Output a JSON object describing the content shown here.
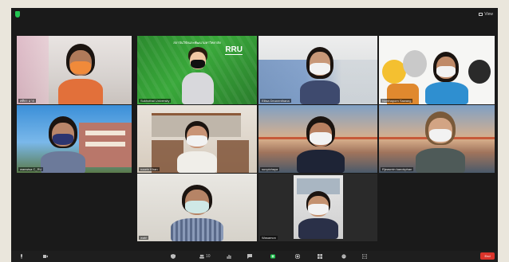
{
  "app": {
    "view_label": "View",
    "end_label": "End"
  },
  "participants": [
    {
      "id": "p1",
      "name": "ศศิธร มาก"
    },
    {
      "id": "p2",
      "name": "Sukhothai University",
      "banner": "สถาบันวิจัยและพัฒนามหาวิทยาลัย",
      "logo": "RRU"
    },
    {
      "id": "p3",
      "name": "Ellisa Deunenthana"
    },
    {
      "id": "p4",
      "name": "Nonthaporn Sawang"
    },
    {
      "id": "p5",
      "name": "wanwisa C_RU"
    },
    {
      "id": "p6",
      "name": "naarin Khan"
    },
    {
      "id": "p7",
      "name": "sunpichaya"
    },
    {
      "id": "p8",
      "name": "Rjeasmin kanokphan"
    },
    {
      "id": "p9",
      "name": "watri"
    },
    {
      "id": "p10",
      "name": "Wasamon"
    }
  ],
  "toolbar": {
    "items": [
      {
        "name": "mute",
        "icon": "microphone-icon"
      },
      {
        "name": "video",
        "icon": "video-camera-icon"
      },
      {
        "name": "security",
        "icon": "shield-icon"
      },
      {
        "name": "participants",
        "icon": "participants-icon",
        "count": "10"
      },
      {
        "name": "polls",
        "icon": "bar-chart-icon"
      },
      {
        "name": "chat",
        "icon": "chat-icon"
      },
      {
        "name": "share",
        "icon": "share-screen-icon"
      },
      {
        "name": "record",
        "icon": "record-icon"
      },
      {
        "name": "breakout",
        "icon": "breakout-rooms-icon"
      },
      {
        "name": "reactions",
        "icon": "reactions-icon"
      },
      {
        "name": "more",
        "icon": "more-icon"
      }
    ]
  },
  "colors": {
    "accent_green": "#23c552",
    "end_red": "#d9342b",
    "active_speaker": "#e6d84a"
  }
}
